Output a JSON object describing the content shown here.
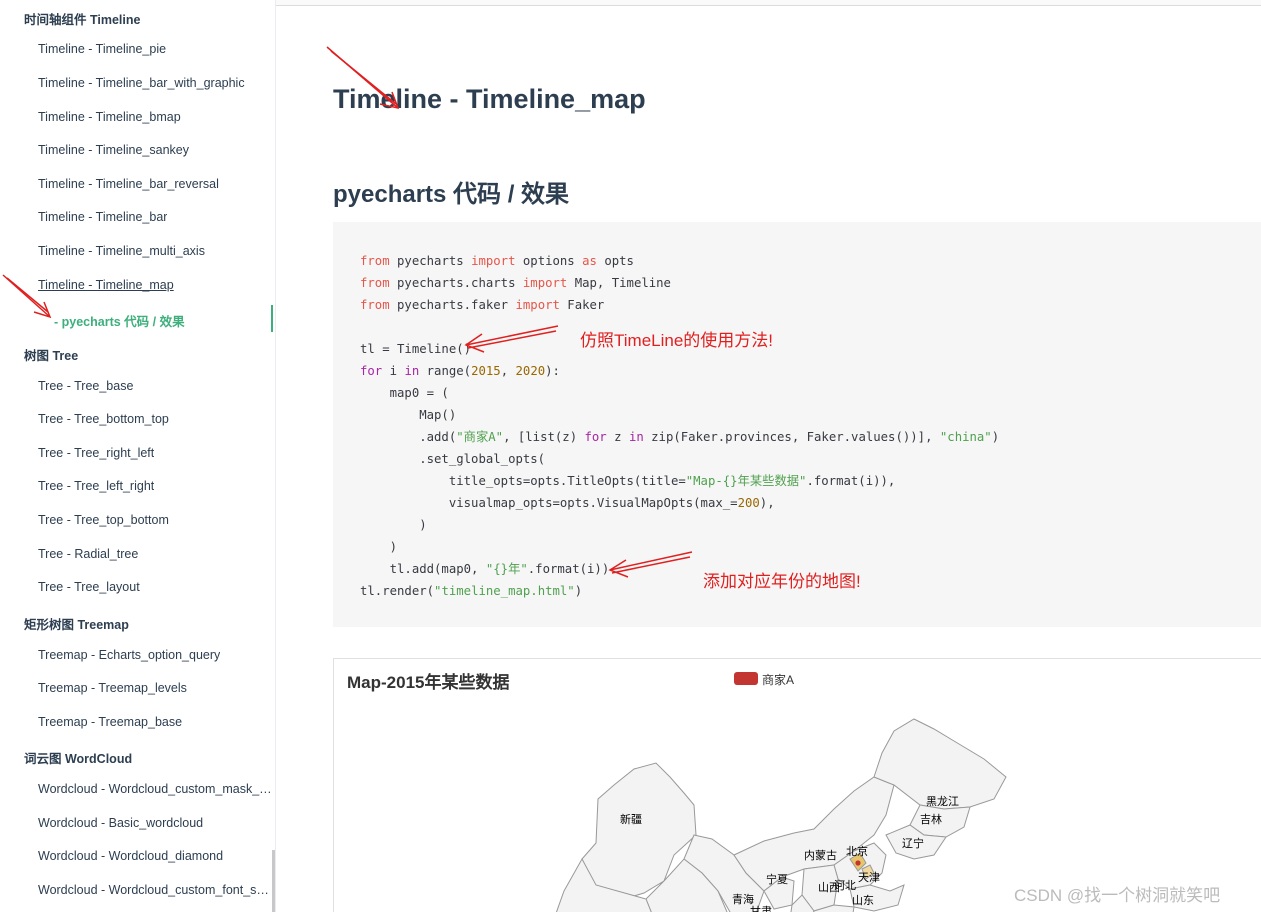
{
  "sidebar": {
    "headings": [
      "时间轴组件 Timeline",
      "树图 Tree",
      "矩形树图 Treemap",
      "词云图 WordCloud"
    ],
    "timeline_items": [
      "Timeline - Timeline_pie",
      "Timeline - Timeline_bar_with_graphic",
      "Timeline - Timeline_bmap",
      "Timeline - Timeline_sankey",
      "Timeline - Timeline_bar_reversal",
      "Timeline - Timeline_bar",
      "Timeline - Timeline_multi_axis",
      "Timeline - Timeline_map"
    ],
    "active_sub_item": "- pyecharts 代码 / 效果",
    "tree_items": [
      "Tree - Tree_base",
      "Tree - Tree_bottom_top",
      "Tree - Tree_right_left",
      "Tree - Tree_left_right",
      "Tree - Tree_top_bottom",
      "Tree - Radial_tree",
      "Tree - Tree_layout"
    ],
    "treemap_items": [
      "Treemap - Echarts_option_query",
      "Treemap - Treemap_levels",
      "Treemap - Treemap_base"
    ],
    "wordcloud_items": [
      "Wordcloud - Wordcloud_custom_mask_image",
      "Wordcloud - Basic_wordcloud",
      "Wordcloud - Wordcloud_diamond",
      "Wordcloud - Wordcloud_custom_font_style"
    ]
  },
  "main": {
    "title": "Timeline - Timeline_map",
    "subtitle": "pyecharts 代码 / 效果",
    "annotation_1": "仿照TimeLine的使用方法!",
    "annotation_2": "添加对应年份的地图!"
  },
  "code": {
    "l1": [
      "from",
      " pyecharts ",
      "import",
      " options ",
      "as",
      " opts"
    ],
    "l2": [
      "from",
      " pyecharts.charts ",
      "import",
      " Map, Timeline"
    ],
    "l3": [
      "from",
      " pyecharts.faker ",
      "import",
      " Faker"
    ],
    "l5": "tl = Timeline()",
    "l6": [
      "for",
      " i ",
      "in",
      " range(",
      "2015",
      ", ",
      "2020",
      "):"
    ],
    "l7": "    map0 = (",
    "l8": "        Map()",
    "l9": [
      "        .add(",
      "\"商家A\"",
      ", [list(z) ",
      "for",
      " z ",
      "in",
      " zip(Faker.provinces, Faker.values())], ",
      "\"china\"",
      ")"
    ],
    "l10": "        .set_global_opts(",
    "l11": [
      "            title_opts=opts.TitleOpts(title=",
      "\"Map-{}年某些数据\"",
      ".format(i)),"
    ],
    "l12": [
      "            visualmap_opts=opts.VisualMapOpts(max_=",
      "200",
      "),"
    ],
    "l13": "        )",
    "l14": "    )",
    "l15": [
      "    tl.add(map0, ",
      "\"{}年\"",
      ".format(i))"
    ],
    "l16": [
      "tl.render(",
      "\"timeline_map.html\"",
      ")"
    ]
  },
  "chart": {
    "title": "Map-2015年某些数据",
    "legend": "商家A",
    "legend_color": "#c23531",
    "provinces": [
      "新疆",
      "黑龙江",
      "吉林",
      "辽宁",
      "内蒙古",
      "北京",
      "天津",
      "宁夏",
      "河北",
      "山西",
      "山东",
      "青海",
      "甘肃"
    ]
  },
  "watermark": "CSDN @找一个树洞就笑吧",
  "colors": {
    "accent": "#3eaf7c",
    "annotation": "#e02020",
    "map_fill": "#f3f3f3",
    "map_stroke": "#999999"
  }
}
